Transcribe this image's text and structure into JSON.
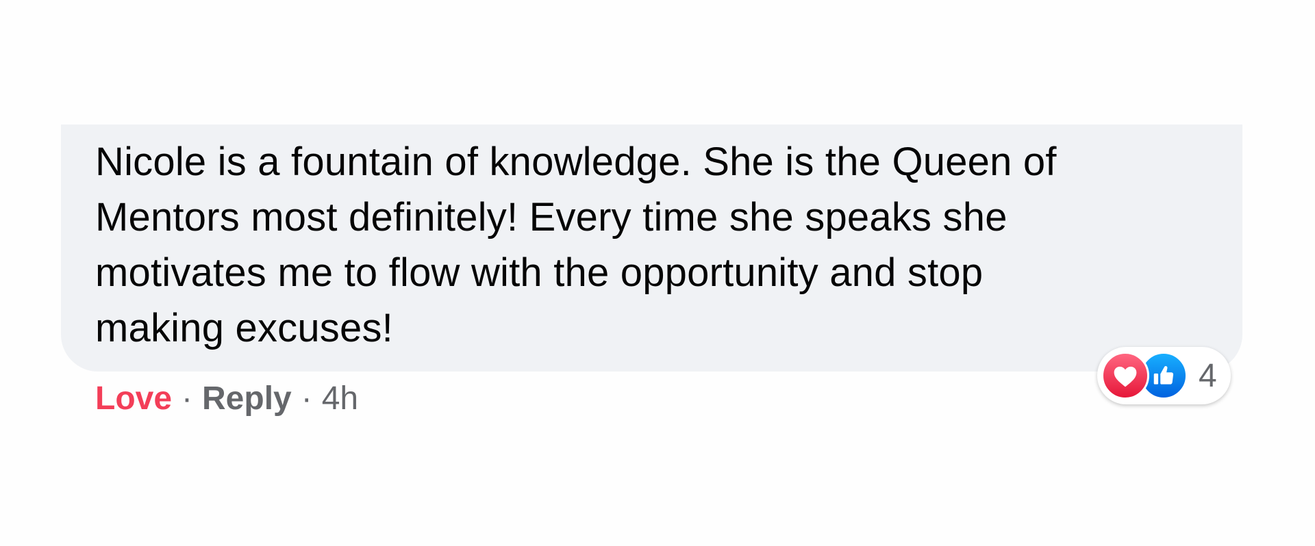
{
  "comment": {
    "text": "Nicole is a fountain of knowledge. She is the Queen of\nMentors most definitely! Every time she speaks she\nmotivates me to flow with the opportunity and stop\nmaking excuses!"
  },
  "actions": {
    "love_label": "Love",
    "separator": "·",
    "reply_label": "Reply",
    "time": "4h"
  },
  "reactions": {
    "icons": [
      "love-reaction-icon",
      "like-reaction-icon"
    ],
    "count": "4",
    "colors": {
      "love": "#f33e58",
      "like": "#1877f2"
    }
  },
  "colors": {
    "bubble": "#f0f2f5",
    "text": "#050505",
    "secondary": "#65676b"
  }
}
